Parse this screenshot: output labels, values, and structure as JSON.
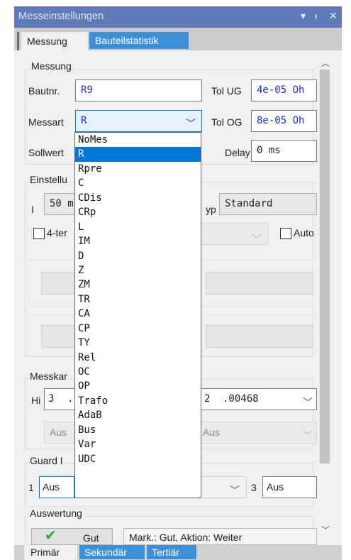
{
  "window": {
    "title": "Messeinstellungen",
    "controls": {
      "pin": "▾",
      "dock": "ᵻ",
      "close": "✕"
    }
  },
  "tabs_top": [
    {
      "label": "Messung",
      "active": true
    },
    {
      "label": "Bauteilstatistik",
      "active": false
    }
  ],
  "messung": {
    "group_label": "Messung",
    "bautnr_label": "Bautnr.",
    "bautnr_value": "R9",
    "tol_ug_label": "Tol UG",
    "tol_ug_value": "4e-05 Oh",
    "messart_label": "Messart",
    "messart_value": "R",
    "tol_og_label": "Tol OG",
    "tol_og_value": "8e-05 Oh",
    "sollwert_label": "Sollwert",
    "delay_label": "Delay",
    "delay_value": "0 ms"
  },
  "einstellungen": {
    "group_label": "Einstellu",
    "i_label": "I",
    "i_value": "50 m",
    "typ_label": "yp",
    "typ_value": "Standard",
    "four_terminal_label": "4-ter",
    "auto_label": "Auto"
  },
  "messkanal": {
    "group_label": "Messkar",
    "hi_label": "Hi",
    "hi_value": "3",
    "hi_dot": ".",
    "lo_num": "2",
    "lo_value": ".00468",
    "aus_left": "Aus",
    "aus_right": "Aus"
  },
  "guard": {
    "group_label": "Guard I",
    "num1": "1",
    "value1": "Aus",
    "num3": "3",
    "value3": "Aus"
  },
  "auswertung": {
    "group_label": "Auswertung",
    "gut_label": "Gut",
    "mark_text": "Mark.: Gut, Aktion: Weiter"
  },
  "tabs_bottom": [
    {
      "label": "Primär",
      "active": true
    },
    {
      "label": "Sekundär",
      "active": false
    },
    {
      "label": "Tertiär",
      "active": false
    }
  ],
  "dropdown": {
    "selected": "R",
    "options": [
      "NoMes",
      "R",
      "Rpre",
      "C",
      "CDis",
      "CRp",
      "L",
      "IM",
      "D",
      "Z",
      "ZM",
      "TR",
      "CA",
      "CP",
      "TY",
      "Rel",
      "OC",
      "OP",
      "Trafo",
      "AdaB",
      "Bus",
      "Var",
      "UDC"
    ]
  },
  "colors": {
    "titlebar": "#5f7ab8",
    "tab_inactive": "#3d8fd6",
    "selection": "#0078d7",
    "value_blue": "#1a2fc8",
    "check_green": "#2ea82e"
  }
}
